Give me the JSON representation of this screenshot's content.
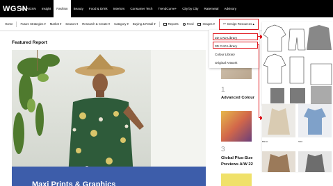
{
  "brand": {
    "logo_text": "WGSN"
  },
  "top_nav": {
    "items": [
      {
        "label": "My WGSN"
      },
      {
        "label": "Insight"
      },
      {
        "label": "Fashion",
        "active": true
      },
      {
        "label": "Beauty"
      },
      {
        "label": "Food & Drink"
      },
      {
        "label": "Interiors"
      },
      {
        "label": "Consumer Tech"
      },
      {
        "label": "TrendCurve+"
      },
      {
        "label": "City by City"
      },
      {
        "label": "Ratemetal"
      },
      {
        "label": "Advisory"
      }
    ]
  },
  "sub_nav": {
    "items": [
      {
        "label": "Home"
      },
      {
        "label": "Future Strategies ▾"
      },
      {
        "label": "Market ▾"
      },
      {
        "label": "Season ▾"
      },
      {
        "label": "Research & Create ▾"
      },
      {
        "label": "Category ▾"
      },
      {
        "label": "Buying & Retail ▾"
      },
      {
        "label": "Reports"
      },
      {
        "label": "Feed"
      },
      {
        "label": "Images ▾"
      },
      {
        "label": "Design Resources ▴"
      }
    ]
  },
  "dropdown": {
    "items": [
      {
        "label": "2D CAD Library"
      },
      {
        "label": "3D CAD Library"
      },
      {
        "label": "Colour Library"
      },
      {
        "label": "Original Artwork"
      }
    ]
  },
  "featured": {
    "heading": "Featured Report",
    "banner_text": "Maxi Prints & Graphics"
  },
  "cards": [
    {
      "number": "1",
      "title": "Advanced Colour"
    },
    {
      "number": "3",
      "title": "Global Plus-Size",
      "subtitle": "Previews A/W 22"
    }
  ],
  "panel_3d_labels": [
    "Blazer",
    "Shirt"
  ],
  "colors": {
    "accent_red": "#e0141b",
    "banner_blue": "#3d5daa",
    "nav_black": "#000000"
  }
}
